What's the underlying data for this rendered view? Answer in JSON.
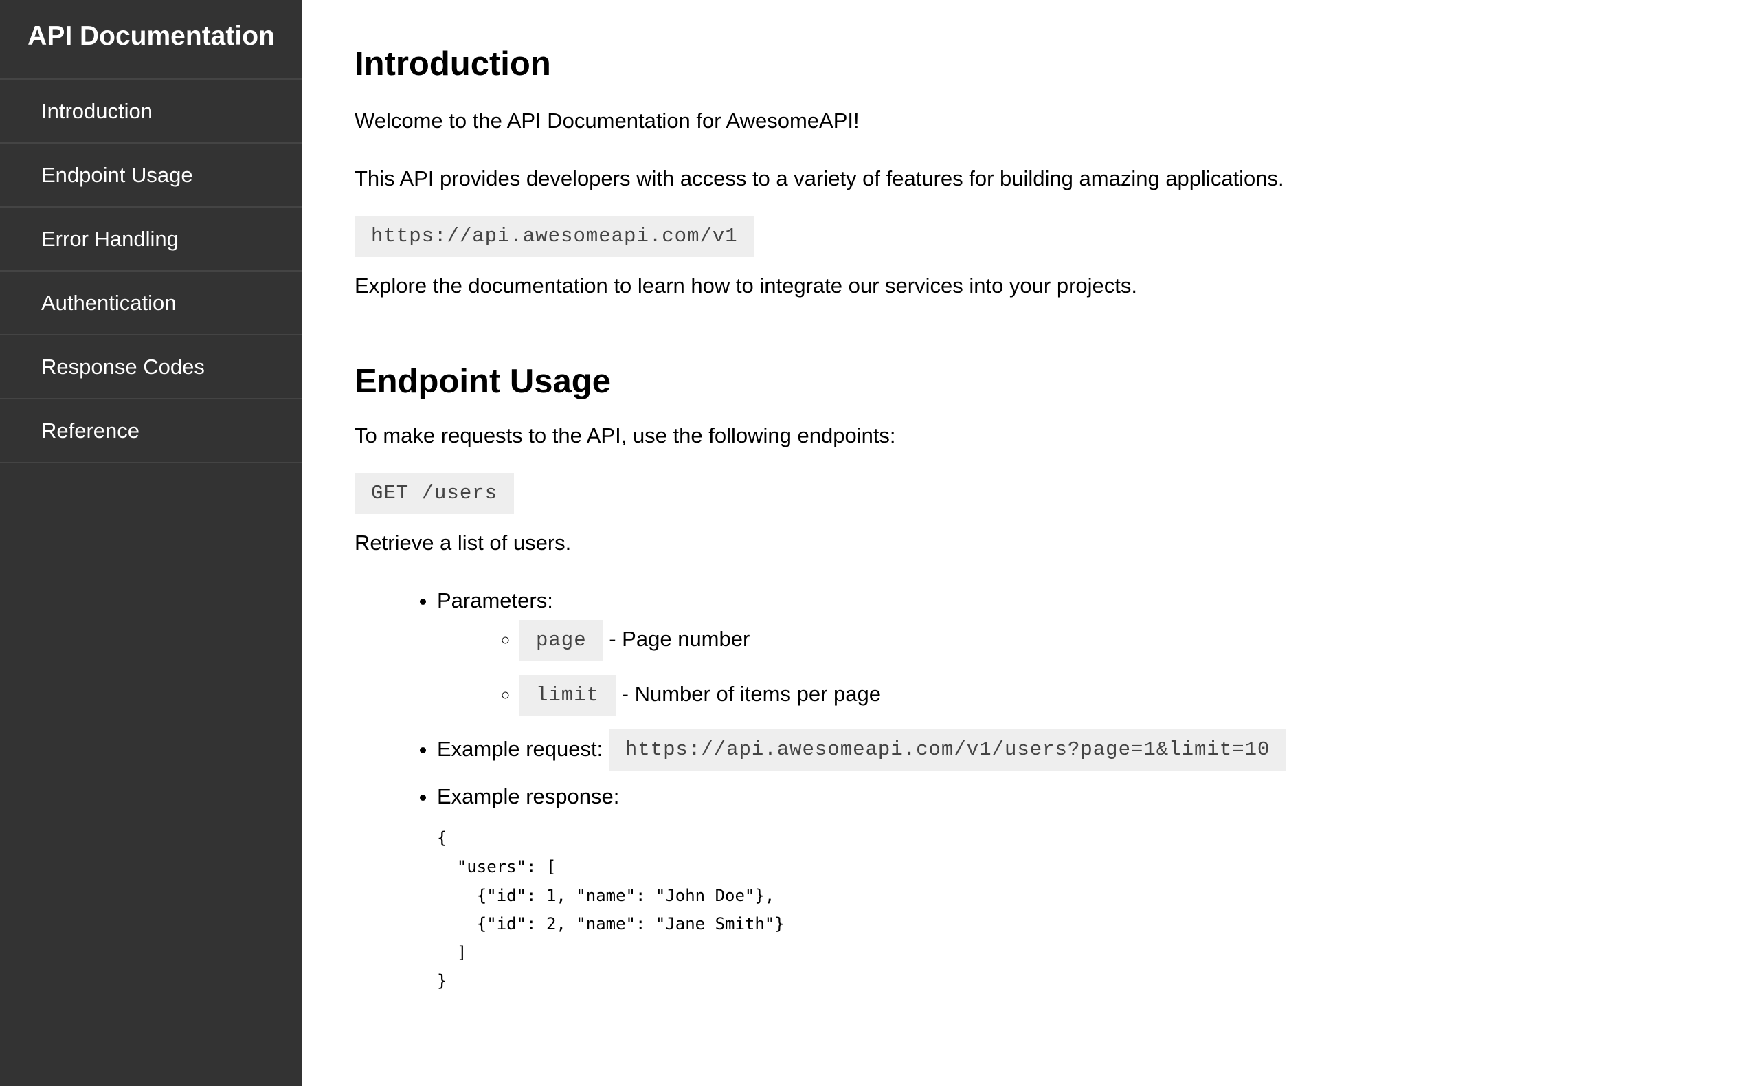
{
  "sidebar": {
    "title": "API Documentation",
    "items": [
      {
        "label": "Introduction"
      },
      {
        "label": "Endpoint Usage"
      },
      {
        "label": "Error Handling"
      },
      {
        "label": "Authentication"
      },
      {
        "label": "Response Codes"
      },
      {
        "label": "Reference"
      }
    ]
  },
  "intro": {
    "heading": "Introduction",
    "p1": "Welcome to the API Documentation for AwesomeAPI!",
    "p2": "This API provides developers with access to a variety of features for building amazing applications.",
    "base_url": "https://api.awesomeapi.com/v1",
    "p3": "Explore the documentation to learn how to integrate our services into your projects."
  },
  "endpoint": {
    "heading": "Endpoint Usage",
    "p1": "To make requests to the API, use the following endpoints:",
    "endpoint_code": "GET /users",
    "p2": "Retrieve a list of users.",
    "params_label": "Parameters:",
    "params": [
      {
        "name": "page",
        "desc": "- Page number"
      },
      {
        "name": "limit",
        "desc": "- Number of items per page"
      }
    ],
    "example_request_label": "Example request:",
    "example_request": "https://api.awesomeapi.com/v1/users?page=1&limit=10",
    "example_response_label": "Example response:",
    "example_response": "{\n  \"users\": [\n    {\"id\": 1, \"name\": \"John Doe\"},\n    {\"id\": 2, \"name\": \"Jane Smith\"}\n  ]\n}"
  }
}
